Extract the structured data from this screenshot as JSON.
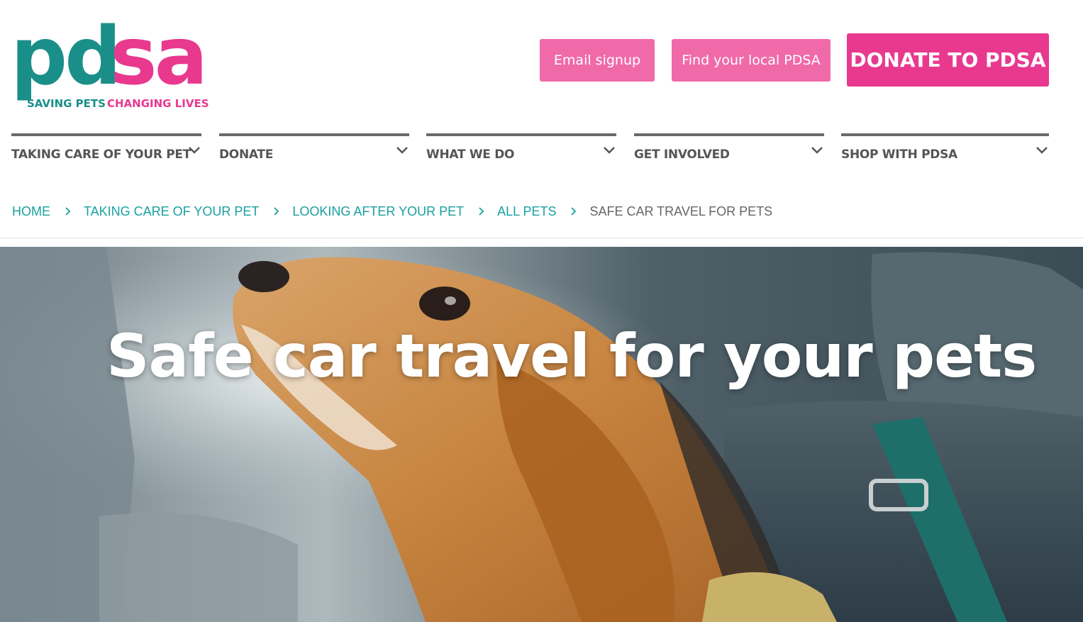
{
  "logo": {
    "wordmark_left": "pd",
    "wordmark_right": "sa",
    "tagline_left": "SAVING PETS",
    "tagline_right": "CHANGING LIVES"
  },
  "header_buttons": {
    "email_signup": "Email signup",
    "find_local": "Find your local PDSA",
    "donate": "DONATE TO PDSA"
  },
  "nav": {
    "items": [
      {
        "label": "TAKING CARE OF YOUR PET"
      },
      {
        "label": "DONATE"
      },
      {
        "label": "WHAT WE DO"
      },
      {
        "label": "GET INVOLVED"
      },
      {
        "label": "SHOP WITH PDSA"
      }
    ]
  },
  "breadcrumb": {
    "items": [
      {
        "label": "HOME"
      },
      {
        "label": "TAKING CARE OF YOUR PET"
      },
      {
        "label": "LOOKING AFTER YOUR PET"
      },
      {
        "label": "ALL PETS"
      }
    ],
    "current": "SAFE CAR TRAVEL FOR PETS"
  },
  "hero": {
    "title": "Safe car travel for your pets"
  },
  "colors": {
    "teal": "#1a8f8a",
    "pink": "#e8398f",
    "pink_light": "#f06aa9",
    "nav_text": "#555555",
    "link_teal": "#1aa0a0"
  }
}
